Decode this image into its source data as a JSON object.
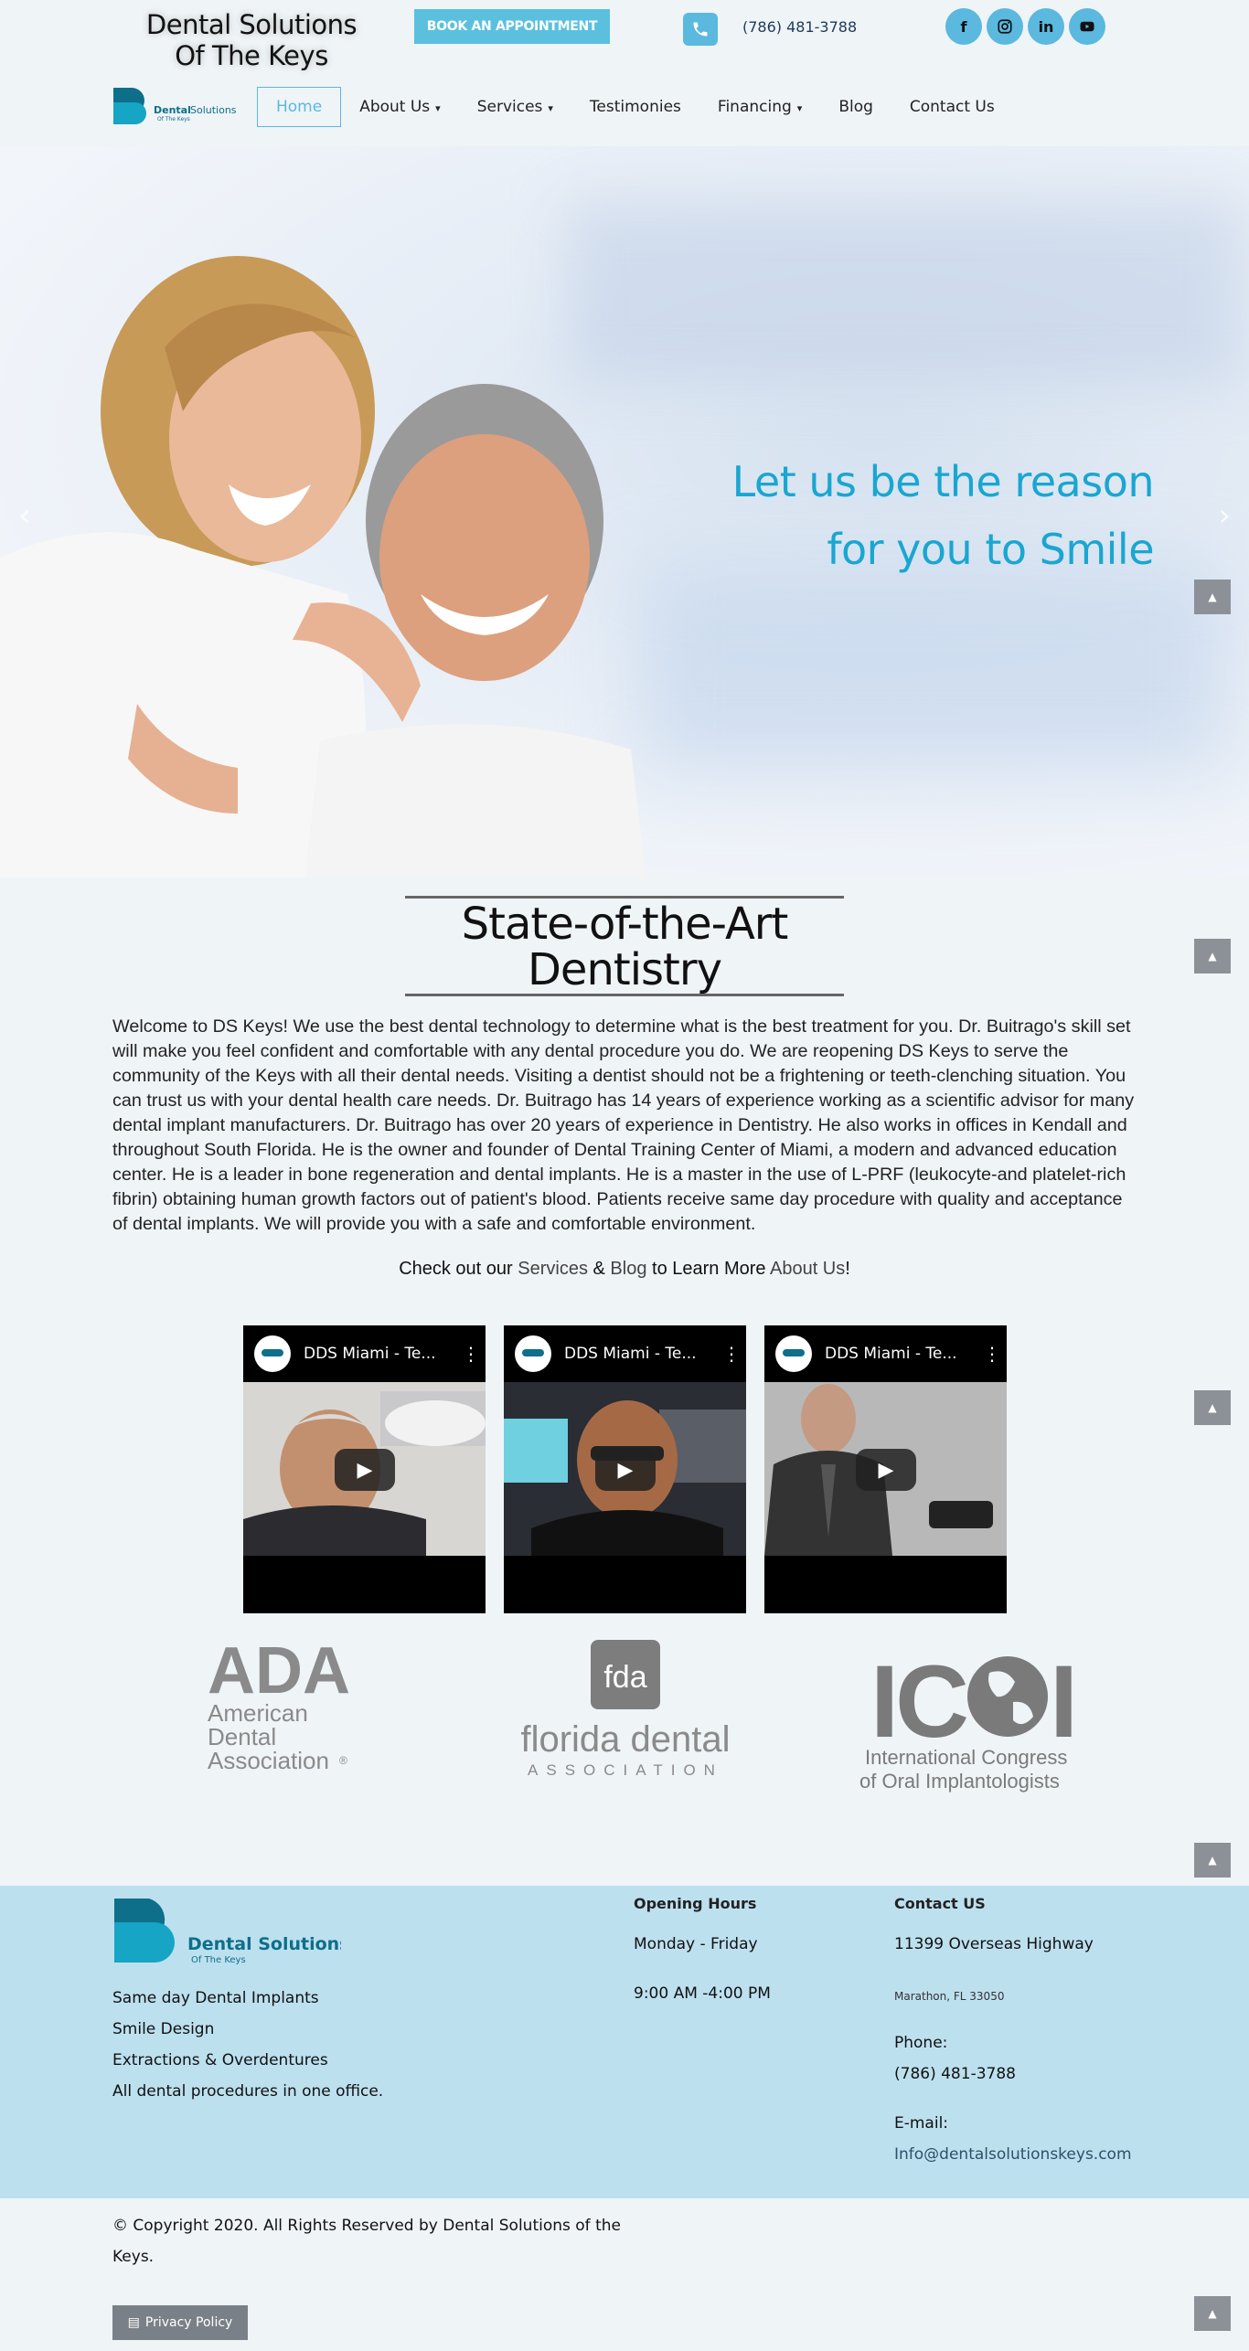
{
  "header": {
    "site_title": "Dental Solutions Of The Keys",
    "book_label": "BOOK AN APPOINTMENT",
    "phone": "(786) 481-3788",
    "socials": [
      {
        "icon": "facebook-icon",
        "glyph": "f"
      },
      {
        "icon": "instagram-icon",
        "glyph": "◎"
      },
      {
        "icon": "linkedin-icon",
        "glyph": "in"
      },
      {
        "icon": "youtube-icon",
        "glyph": "▶"
      }
    ],
    "logo_text": "Dental Solutions",
    "logo_subtext": "Of The Keys"
  },
  "nav": {
    "items": [
      {
        "label": "Home",
        "dropdown": false,
        "active": true
      },
      {
        "label": "About Us",
        "dropdown": true,
        "active": false
      },
      {
        "label": "Services",
        "dropdown": true,
        "active": false
      },
      {
        "label": "Testimonies",
        "dropdown": false,
        "active": false
      },
      {
        "label": "Financing",
        "dropdown": true,
        "active": false
      },
      {
        "label": "Blog",
        "dropdown": false,
        "active": false
      },
      {
        "label": "Contact Us",
        "dropdown": false,
        "active": false
      }
    ]
  },
  "hero": {
    "line1": "Let us be the reason",
    "line2": "for you to Smile",
    "prev": "‹",
    "next": "›"
  },
  "intro": {
    "title_line1": "State-of-the-Art",
    "title_line2": "Dentistry",
    "body": "Welcome to DS Keys! We use the best dental technology to determine what is the best treatment for you. Dr. Buitrago's skill set will make you feel confident and comfortable with any dental procedure you do. We are reopening DS Keys to serve the community of the Keys with all their dental needs. Visiting a dentist should not be a frightening or teeth-clenching situation. You can trust us with your dental health care needs. Dr. Buitrago has 14 years of experience working as a scientific advisor for many dental implant manufacturers. Dr. Buitrago has over 20 years of experience in Dentistry. He also works in offices in Kendall and throughout South Florida. He is the owner and founder of Dental Training Center of Miami, a modern and advanced education center. He is a leader in bone regeneration and dental implants. He is a master in the use of L-PRF (leukocyte-and platelet-rich fibrin) obtaining human growth factors out of patient's blood. Patients receive same day procedure with quality and acceptance of dental implants. We will provide you with a safe and comfortable environment.",
    "checkout_prefix": "Check out our ",
    "checkout_services": "Services",
    "checkout_amp": " & ",
    "checkout_blog": "Blog",
    "checkout_middle": " to Learn More ",
    "checkout_about": "About Us",
    "checkout_suffix": "!"
  },
  "videos": [
    {
      "title": "DDS Miami - Te..."
    },
    {
      "title": "DDS Miami - Te..."
    },
    {
      "title": "DDS Miami - Te..."
    }
  ],
  "logos": {
    "ada": {
      "abbr": "ADA",
      "line1": "American",
      "line2": "Dental",
      "line3": "Association",
      "mark": "®"
    },
    "fda": {
      "badge": "fda",
      "name": "florida dental",
      "sub": "ASSOCIATION"
    },
    "icoi": {
      "abbr_left": "IC",
      "abbr_right": "I",
      "line1": "International Congress",
      "line2": "of Oral Implantologists"
    }
  },
  "footer": {
    "logo_text": "Dental Solutions",
    "logo_subtext": "Of The Keys",
    "services": [
      "Same day Dental Implants",
      "Smile Design",
      "Extractions & Overdentures",
      "All dental procedures in one office."
    ],
    "hours_title": "Opening Hours",
    "hours_days": "Monday - Friday",
    "hours_time": "9:00 AM -4:00 PM",
    "contact_title": "Contact US",
    "address": "11399 Overseas Highway",
    "city": "Marathon, FL 33050",
    "phone_label": "Phone:",
    "phone": "(786) 481-3788",
    "email_label": "E-mail:",
    "email": "Info@dentalsolutionskeys.com"
  },
  "bottom": {
    "copyright": "© Copyright 2020. All Rights Reserved by Dental Solutions of the Keys.",
    "privacy_label": "Privacy Policy"
  },
  "colors": {
    "accent": "#5bc0de",
    "hero_text": "#1aa6d1",
    "footer_bg": "#bde0ef",
    "page_bg": "#eff4f7",
    "logo_dark": "#0e6f8a",
    "logo_light": "#16a5c4"
  }
}
